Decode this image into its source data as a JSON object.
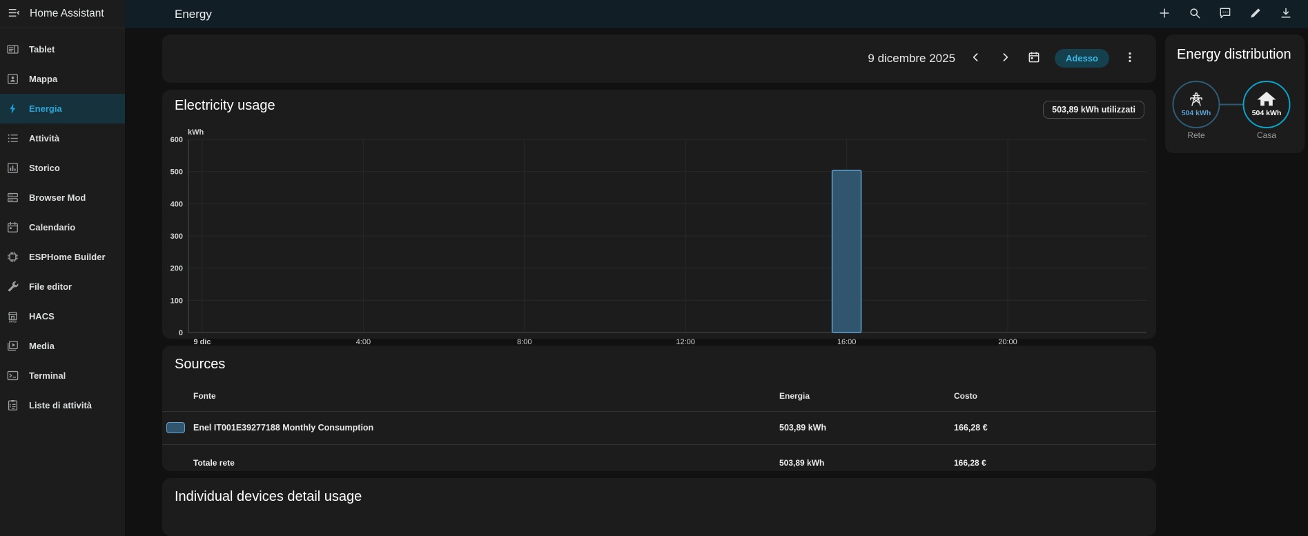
{
  "sidebar": {
    "title": "Home Assistant",
    "toggle_icon": "menu-open-icon",
    "items": [
      {
        "label": "Tablet",
        "icon": "tablet-icon",
        "active": false
      },
      {
        "label": "Mappa",
        "icon": "account-box-icon",
        "active": false
      },
      {
        "label": "Energia",
        "icon": "lightning-bolt-icon",
        "active": true
      },
      {
        "label": "Attività",
        "icon": "list-icon",
        "active": false
      },
      {
        "label": "Storico",
        "icon": "chart-box-icon",
        "active": false
      },
      {
        "label": "Browser Mod",
        "icon": "server-icon",
        "active": false
      },
      {
        "label": "Calendario",
        "icon": "calendar-icon",
        "active": false
      },
      {
        "label": "ESPHome Builder",
        "icon": "chip-icon",
        "active": false
      },
      {
        "label": "File editor",
        "icon": "wrench-icon",
        "active": false
      },
      {
        "label": "HACS",
        "icon": "store-icon",
        "active": false
      },
      {
        "label": "Media",
        "icon": "play-box-icon",
        "active": false
      },
      {
        "label": "Terminal",
        "icon": "console-icon",
        "active": false
      },
      {
        "label": "Liste di attività",
        "icon": "clipboard-list-icon",
        "active": false
      }
    ]
  },
  "topbar": {
    "title": "Energy",
    "actions": [
      "plus-icon",
      "search-icon",
      "chat-icon",
      "pencil-icon",
      "download-icon"
    ]
  },
  "date_picker": {
    "date": "9 dicembre 2025",
    "now_label": "Adesso",
    "icons": [
      "chevron-left-icon",
      "chevron-right-icon",
      "calendar-today-icon",
      "dots-vertical-icon"
    ]
  },
  "electricity_card": {
    "title": "Electricity usage",
    "badge": "503,89 kWh utilizzati"
  },
  "chart_data": {
    "type": "bar",
    "title": "Electricity usage",
    "unit": "kWh",
    "ylabel": "kWh",
    "xlabel": "",
    "ylim": [
      0,
      600
    ],
    "y_ticks": [
      0,
      100,
      200,
      300,
      400,
      500,
      600
    ],
    "x_range_hours": [
      0,
      24
    ],
    "x_ticks": [
      {
        "hour": 0,
        "label": "9 dic",
        "bold": true
      },
      {
        "hour": 4,
        "label": "4:00"
      },
      {
        "hour": 8,
        "label": "8:00"
      },
      {
        "hour": 12,
        "label": "12:00"
      },
      {
        "hour": 16,
        "label": "16:00"
      },
      {
        "hour": 20,
        "label": "20:00"
      }
    ],
    "grid": true,
    "legend": false,
    "series": [
      {
        "name": "Enel IT001E39277188 Monthly Consumption",
        "color": "#32556e",
        "border_color": "#64a1cd",
        "points": [
          {
            "hour": 16,
            "value": 503.89
          }
        ]
      }
    ]
  },
  "sources_card": {
    "title": "Sources",
    "columns": {
      "source": "Fonte",
      "energy": "Energia",
      "cost": "Costo"
    },
    "rows": [
      {
        "name": "Enel IT001E39277188 Monthly Consumption",
        "energy": "503,89 kWh",
        "cost": "166,28 €",
        "swatch_color": "#32556e"
      }
    ],
    "total": {
      "name": "Totale rete",
      "energy": "503,89 kWh",
      "cost": "166,28 €"
    }
  },
  "devices_card": {
    "title": "Individual devices detail usage"
  },
  "distribution_card": {
    "title": "Energy distribution",
    "nodes": [
      {
        "label": "Rete",
        "value": "504 kWh",
        "icon": "transmission-tower-icon",
        "ring_color": "#2c5c77"
      },
      {
        "label": "Casa",
        "value": "504 kWh",
        "icon": "home-icon",
        "ring_color": "#0aa3c9"
      }
    ]
  },
  "colors": {
    "accent": "#2ba4d6",
    "topbar_bg": "#111e25",
    "card_bg": "#1c1c1c",
    "bar_fill": "#32556e",
    "bar_border": "#64a1cd"
  }
}
